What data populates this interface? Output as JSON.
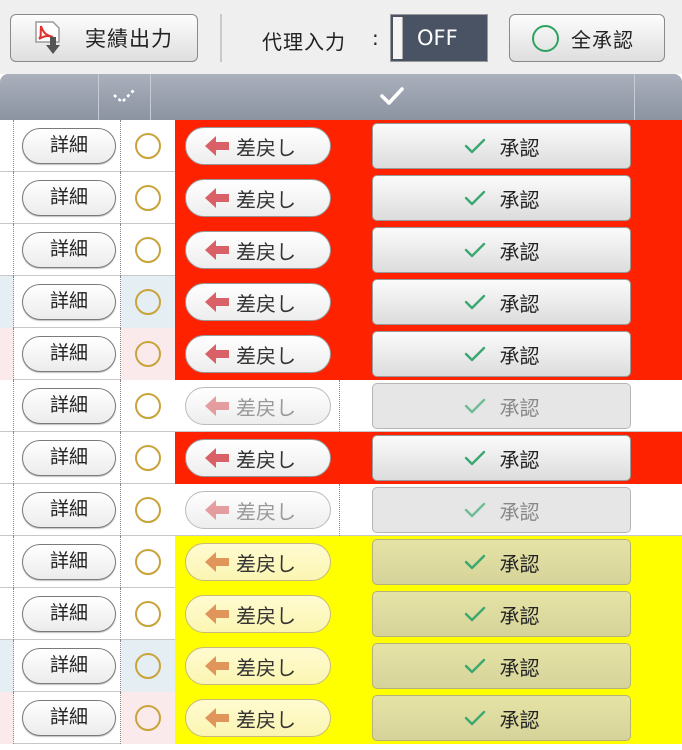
{
  "toolbar": {
    "export_label": "実績出力",
    "export_icon": "pdf-download-icon",
    "proxy_label": "代理入力",
    "proxy_colon": ":",
    "proxy_state": "OFF",
    "approve_all_label": "全承認",
    "approve_all_icon": "circle-icon"
  },
  "header": {
    "select_icon": "check-icon",
    "approve_icon": "check-icon"
  },
  "labels": {
    "detail": "詳細",
    "return": "差戻し",
    "approve": "承認"
  },
  "colors": {
    "red": "#ff2200",
    "yellow": "#ffff00",
    "return_arrow_red": "#d86066",
    "return_arrow_orange": "#e0955a",
    "approve_check": "#3aa870",
    "toggle_bg": "#4a5363"
  },
  "rows": [
    {
      "tint": "none",
      "highlight": "red"
    },
    {
      "tint": "none",
      "highlight": "red"
    },
    {
      "tint": "none",
      "highlight": "red"
    },
    {
      "tint": "blue",
      "highlight": "red"
    },
    {
      "tint": "pink",
      "highlight": "red"
    },
    {
      "tint": "none",
      "highlight": "plain"
    },
    {
      "tint": "none",
      "highlight": "red"
    },
    {
      "tint": "none",
      "highlight": "plain"
    },
    {
      "tint": "none",
      "highlight": "yellow"
    },
    {
      "tint": "none",
      "highlight": "yellow"
    },
    {
      "tint": "blue",
      "highlight": "yellow"
    },
    {
      "tint": "pink",
      "highlight": "yellow"
    }
  ]
}
